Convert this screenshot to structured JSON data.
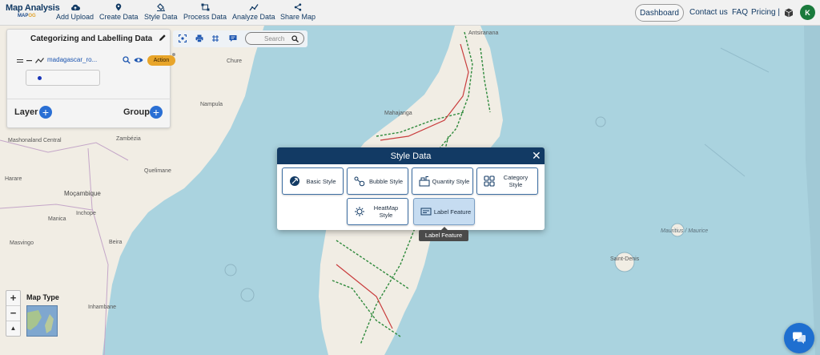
{
  "app": {
    "logo_title": "Map Analysis",
    "logo_sub_main": "MAP",
    "logo_sub_accent": "OG"
  },
  "toolbar": {
    "items": [
      {
        "label": "Add Upload",
        "icon": "cloud-upload-icon"
      },
      {
        "label": "Create Data",
        "icon": "map-pin-icon"
      },
      {
        "label": "Style Data",
        "icon": "paint-bucket-icon"
      },
      {
        "label": "Process Data",
        "icon": "process-icon"
      },
      {
        "label": "Analyze Data",
        "icon": "analyze-chart-icon"
      },
      {
        "label": "Share Map",
        "icon": "share-icon"
      }
    ],
    "dashboard": "Dashboard",
    "contact": "Contact us",
    "faq": "FAQ",
    "pricing": "Pricing |",
    "avatar_initial": "K"
  },
  "panel": {
    "title": "Categorizing and Labelling Data",
    "layer_name": "madagascar_ro...",
    "action_label": "Action",
    "layer_label": "Layer",
    "group_label": "Group"
  },
  "map_tools": {
    "search_placeholder": "Search"
  },
  "map_type": {
    "label": "Map Type",
    "zoom_in": "+",
    "zoom_out": "−",
    "compass": "▲"
  },
  "modal": {
    "title": "Style Data",
    "close": "✕",
    "buttons": [
      {
        "label": "Basic Style",
        "icon": "basic-style-icon"
      },
      {
        "label": "Bubble Style",
        "icon": "bubble-style-icon"
      },
      {
        "label": "Quantity Style",
        "icon": "quantity-style-icon"
      },
      {
        "label": "Category Style",
        "icon": "category-style-icon"
      },
      {
        "label": "HeatMap Style",
        "icon": "heatmap-style-icon"
      },
      {
        "label": "Label Feature",
        "icon": "label-feature-icon",
        "active": true
      }
    ],
    "tooltip": "Label Feature"
  },
  "map_labels": {
    "mahajanga": "Mahajanga",
    "mozambique": "Moçambique",
    "harare": "Harare",
    "beira": "Beira",
    "quelimane": "Quelimane",
    "chure": "Chure",
    "mauritius": "Mauritius / Maurice",
    "saint_denis": "Saint-Denis",
    "inhambane": "Inhambane",
    "mashonaland": "Mashonaland Central",
    "manica": "Manica",
    "inchope": "Inchope",
    "nampula": "Nampula",
    "zambezia": "Zambézia",
    "masvingo": "Masvingo",
    "maputo": "Inhambane",
    "antsiranana": "Antsiranana"
  },
  "colors": {
    "brand": "#123a64",
    "accent": "#e8a52a",
    "plus_blue": "#2a6fd4",
    "avatar_green": "#1a7a3c",
    "chat_blue": "#1f6fd0"
  }
}
